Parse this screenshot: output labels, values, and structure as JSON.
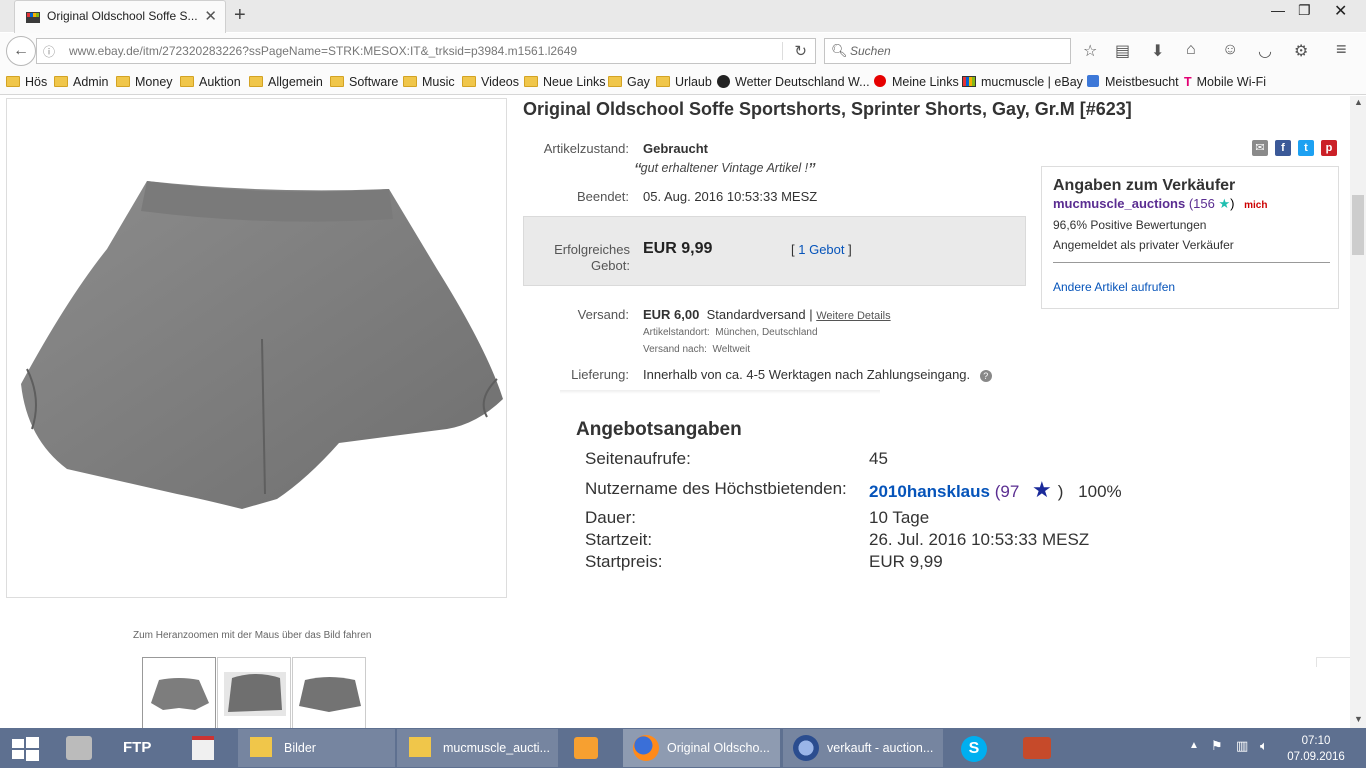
{
  "browser": {
    "tab_title": "Original Oldschool Soffe S...",
    "url": "www.ebay.de/itm/272320283226?ssPageName=STRK:MESOX:IT&_trksid=p3984.m1561.l2649",
    "search_placeholder": "Suchen"
  },
  "bookmarks": [
    {
      "label": "Hös",
      "icon": "folder"
    },
    {
      "label": "Admin",
      "icon": "folder"
    },
    {
      "label": "Money",
      "icon": "folder"
    },
    {
      "label": "Auktion",
      "icon": "folder"
    },
    {
      "label": "Allgemein",
      "icon": "folder"
    },
    {
      "label": "Software",
      "icon": "folder"
    },
    {
      "label": "Music",
      "icon": "folder"
    },
    {
      "label": "Videos",
      "icon": "folder"
    },
    {
      "label": "Neue Links",
      "icon": "folder"
    },
    {
      "label": "Gay",
      "icon": "folder"
    },
    {
      "label": "Urlaub",
      "icon": "folder"
    },
    {
      "label": "Wetter Deutschland W...",
      "icon": "clock"
    },
    {
      "label": "Meine Links",
      "icon": "vodafone"
    },
    {
      "label": "mucmuscle | eBay",
      "icon": "ebay"
    },
    {
      "label": "Meistbesucht",
      "icon": "star-page"
    },
    {
      "label": "Mobile Wi-Fi",
      "icon": "telekom"
    }
  ],
  "listing": {
    "title": "Original Oldschool Soffe Sportshorts, Sprinter Shorts, Gay, Gr.M [#623]",
    "zoom_hint": "Zum Heranzoomen mit der Maus über das Bild fahren",
    "condition_label": "Artikelzustand:",
    "condition_value": "Gebraucht",
    "condition_quote": "gut erhaltener Vintage Artikel !",
    "ended_label": "Beendet:",
    "ended_value": "05. Aug. 2016  10:53:33 MESZ",
    "bid_label_1": "Erfolgreiches",
    "bid_label_2": "Gebot:",
    "bid_price": "EUR 9,99",
    "bid_count_open": "[",
    "bid_count": "1 Gebot",
    "bid_count_close": "]",
    "shipping_label": "Versand:",
    "shipping_price": "EUR 6,00",
    "shipping_method": "Standardversand |",
    "shipping_details": "Weitere Details",
    "location_label": "Artikelstandort:",
    "location_value": "München, Deutschland",
    "ships_to_label": "Versand nach:",
    "ships_to_value": "Weltweit",
    "delivery_label": "Lieferung:",
    "delivery_value": "Innerhalb von ca. 4-5 Werktagen nach Zahlungseingang."
  },
  "seller": {
    "heading": "Angaben zum Verkäufer",
    "name": "mucmuscle_auctions",
    "score": "(156",
    "score_close": ")",
    "me_badge": "mich",
    "positive": "96,6% Positive Bewertungen",
    "registered": "Angemeldet als privater Verkäufer",
    "other_items": "Andere Artikel aufrufen"
  },
  "angebot": {
    "heading": "Angebotsangaben",
    "views_label": "Seitenaufrufe:",
    "views_value": "45",
    "bidder_label": "Nutzername des Höchstbietenden:",
    "bidder_name": "2010hansklaus",
    "bidder_score": "(97",
    "bidder_close": ")",
    "bidder_pct": "100%",
    "duration_label": "Dauer:",
    "duration_value": "10 Tage",
    "start_label": "Startzeit:",
    "start_value": "26. Jul. 2016 10:53:33 MESZ",
    "startprice_label": "Startpreis:",
    "startprice_value": "EUR 9,99"
  },
  "taskbar": {
    "items": [
      "Bilder",
      "mucmuscle_aucti...",
      "Original Oldscho...",
      "verkauft - auction..."
    ],
    "clock_time": "07:10",
    "clock_date": "07.09.2016"
  },
  "colors": {
    "link": "#0654ba",
    "seller_purple": "#5a2d91",
    "taskbar": "#5e7090",
    "star_teal": "#1fbfb0"
  }
}
